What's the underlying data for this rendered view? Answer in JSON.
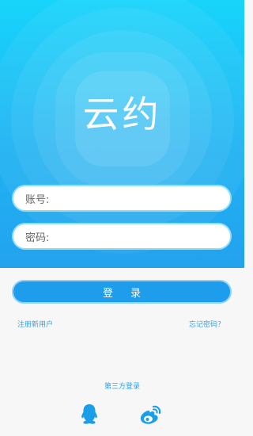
{
  "app": {
    "logo_text": "云约"
  },
  "form": {
    "account_label": "账号:",
    "account_value": "",
    "password_label": "密码:",
    "password_value": "",
    "login_label": "登录"
  },
  "links": {
    "register": "注册新用户",
    "forgot": "忘记密码？"
  },
  "third_party": {
    "title": "第三方登录",
    "providers": [
      {
        "name": "qq",
        "icon": "qq-icon"
      },
      {
        "name": "weibo",
        "icon": "weibo-icon"
      }
    ]
  },
  "colors": {
    "hero_top": "#18d4fb",
    "hero_bottom": "#23a2ee",
    "button": "#1f9ded",
    "link": "#3aa0e0",
    "background": "#f7f7f7"
  }
}
